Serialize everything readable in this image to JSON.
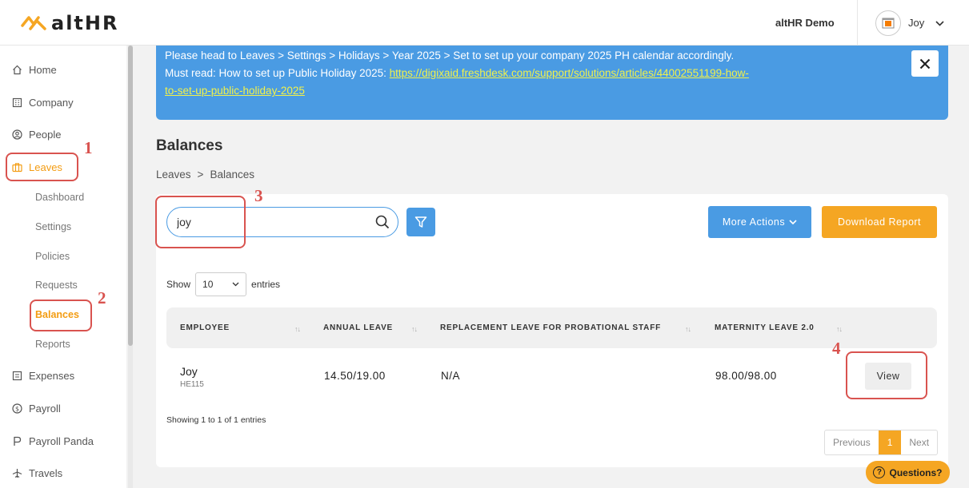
{
  "header": {
    "logo_text": "altHR",
    "company": "altHR Demo",
    "user_name": "Joy"
  },
  "sidebar": {
    "items": [
      {
        "label": "Home",
        "icon": "home-icon"
      },
      {
        "label": "Company",
        "icon": "building-icon"
      },
      {
        "label": "People",
        "icon": "person-icon"
      },
      {
        "label": "Leaves",
        "icon": "briefcase-icon"
      },
      {
        "label": "Expenses",
        "icon": "receipt-icon"
      },
      {
        "label": "Payroll",
        "icon": "dollar-icon"
      },
      {
        "label": "Payroll Panda",
        "icon": "p-icon"
      },
      {
        "label": "Travels",
        "icon": "plane-icon"
      }
    ],
    "leaves_sub": [
      "Dashboard",
      "Settings",
      "Policies",
      "Requests",
      "Balances",
      "Reports"
    ]
  },
  "annotations": [
    "1",
    "2",
    "3",
    "4"
  ],
  "banner": {
    "line1": "Please head to Leaves > Settings > Holidays > Year 2025 > Set to set up your company 2025 PH calendar accordingly.",
    "line2_prefix": "Must read: How to set up Public Holiday 2025: ",
    "link_part1": "https://digixaid.freshdesk.com/support/solutions/articles/44002551199-how-",
    "link_part2": "to-set-up-public-holiday-2025"
  },
  "page": {
    "title": "Balances",
    "breadcrumb": [
      "Leaves",
      ">",
      "Balances"
    ]
  },
  "toolbar": {
    "search_value": "joy",
    "more_actions": "More Actions",
    "download_report": "Download Report"
  },
  "table": {
    "show_label": "Show",
    "page_size": "10",
    "entries_label": "entries",
    "headers": [
      "EMPLOYEE",
      "ANNUAL LEAVE",
      "REPLACEMENT LEAVE FOR PROBATIONAL STAFF",
      "MATERNITY LEAVE 2.0"
    ],
    "rows": [
      {
        "name": "Joy",
        "id": "HE115",
        "annual": "14.50/19.00",
        "replacement": "N/A",
        "maternity": "98.00/98.00",
        "action": "View"
      }
    ],
    "showing": "Showing 1 to 1 of 1 entries",
    "pager": [
      "Previous",
      "1",
      "Next"
    ]
  },
  "help": {
    "label": "Questions?",
    "icon_glyph": "?"
  }
}
